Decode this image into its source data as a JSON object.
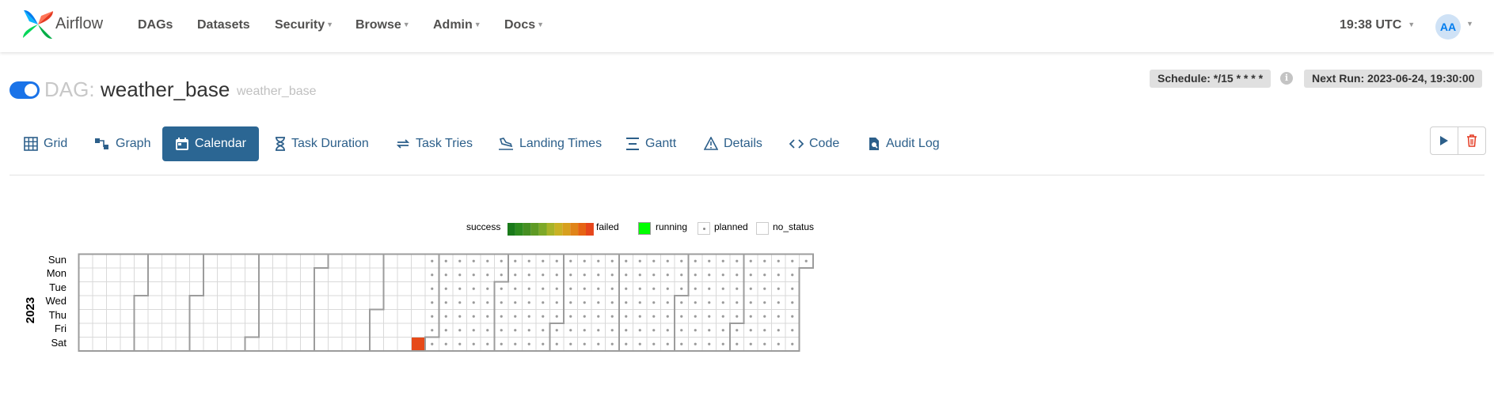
{
  "navbar": {
    "brand": "Airflow",
    "items": [
      {
        "label": "DAGs",
        "dropdown": false
      },
      {
        "label": "Datasets",
        "dropdown": false
      },
      {
        "label": "Security",
        "dropdown": true
      },
      {
        "label": "Browse",
        "dropdown": true
      },
      {
        "label": "Admin",
        "dropdown": true
      },
      {
        "label": "Docs",
        "dropdown": true
      }
    ],
    "time": "19:38 UTC",
    "avatar_initials": "AA"
  },
  "dag": {
    "prefix": "DAG:",
    "id": "weather_base",
    "subtitle": "weather_base",
    "paused": false,
    "schedule": "Schedule: */15 * * * *",
    "next_run": "Next Run: 2023-06-24, 19:30:00"
  },
  "tabs": [
    {
      "label": "Grid",
      "icon": "grid-icon",
      "active": false
    },
    {
      "label": "Graph",
      "icon": "graph-icon",
      "active": false
    },
    {
      "label": "Calendar",
      "icon": "calendar-icon",
      "active": true
    },
    {
      "label": "Task Duration",
      "icon": "hourglass-icon",
      "active": false
    },
    {
      "label": "Task Tries",
      "icon": "retry-icon",
      "active": false
    },
    {
      "label": "Landing Times",
      "icon": "plane-landing-icon",
      "active": false
    },
    {
      "label": "Gantt",
      "icon": "gantt-icon",
      "active": false
    },
    {
      "label": "Details",
      "icon": "warning-triangle-icon",
      "active": false
    },
    {
      "label": "Code",
      "icon": "code-icon",
      "active": false
    },
    {
      "label": "Audit Log",
      "icon": "file-search-icon",
      "active": false
    }
  ],
  "actions": [
    {
      "name": "trigger-dag-button",
      "icon": "play-icon"
    },
    {
      "name": "delete-dag-button",
      "icon": "trash-icon"
    }
  ],
  "legend": {
    "success_label": "success",
    "failed_label": "failed",
    "running_label": "running",
    "planned_label": "planned",
    "no_status_label": "no_status",
    "gradient_colors": [
      "#1a7a1a",
      "#2e8b1e",
      "#468f22",
      "#5e9a25",
      "#7da828",
      "#a8b328",
      "#c9b224",
      "#d7a01e",
      "#e08419",
      "#e66414",
      "#e6461c"
    ],
    "running_color": "#00ff00"
  },
  "calendar": {
    "year": "2023",
    "weekdays": [
      "Sun",
      "Mon",
      "Tue",
      "Wed",
      "Thu",
      "Fri",
      "Sat"
    ],
    "failed_date": "2023-06-24",
    "planned_from": "2023-06-25",
    "failed_color": "#e64a19"
  }
}
